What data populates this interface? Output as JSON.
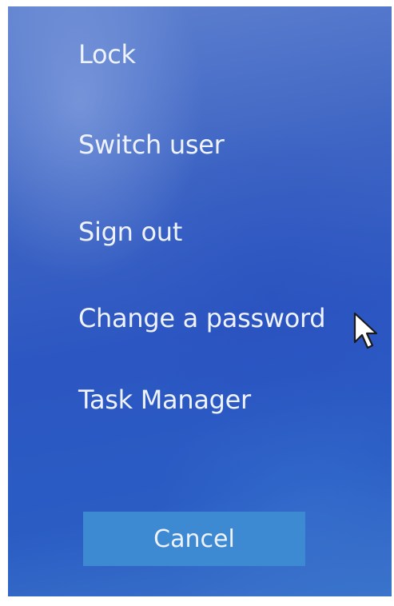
{
  "menu": {
    "items": [
      {
        "id": "lock",
        "label": "Lock"
      },
      {
        "id": "switch-user",
        "label": "Switch user"
      },
      {
        "id": "sign-out",
        "label": "Sign out"
      },
      {
        "id": "change-password",
        "label": "Change a password"
      },
      {
        "id": "task-manager",
        "label": "Task Manager"
      }
    ]
  },
  "cancel": {
    "label": "Cancel"
  },
  "cursor": {
    "icon": "mouse-pointer-icon"
  },
  "colors": {
    "background": "#2c56c2",
    "button": "#3d8ad2",
    "text": "#eef2fb"
  }
}
